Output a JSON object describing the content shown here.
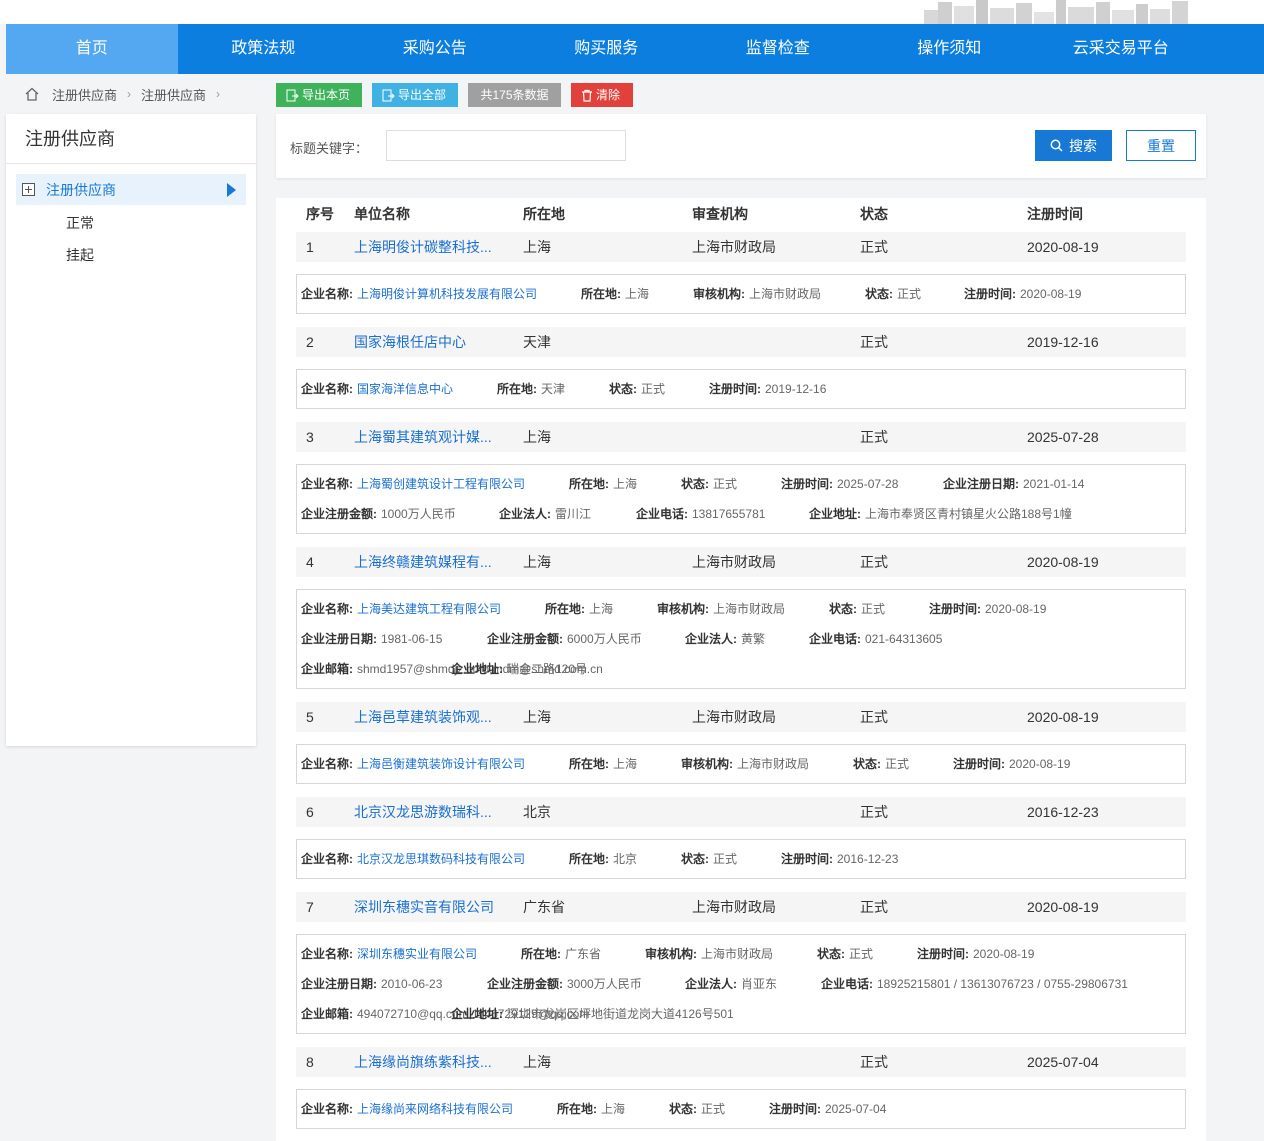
{
  "nav": [
    "首页",
    "政策法规",
    "采购公告",
    "购买服务",
    "监督检查",
    "操作须知",
    "云采交易平台"
  ],
  "breadcrumb": [
    "注册供应商",
    "注册供应商"
  ],
  "toolbar": {
    "export_page": "导出本页",
    "export_all": "导出全部",
    "count": "共175条数据",
    "clear": "清除"
  },
  "sidebar": {
    "title": "注册供应商",
    "active": "注册供应商",
    "subs": [
      "正常",
      "挂起"
    ]
  },
  "search": {
    "label": "标题关键字：",
    "value": "",
    "placeholder": "",
    "search_btn": "搜索",
    "reset_btn": "重置"
  },
  "table": {
    "headers": [
      "序号",
      "单位名称",
      "所在地",
      "审查机构",
      "状态",
      "注册时间"
    ],
    "rows": [
      {
        "idx": "1",
        "name": "上海明俊计碳整科技...",
        "loc": "上海",
        "org": "上海市财政局",
        "status": "正式",
        "time": "2020-08-19",
        "detail": [
          [
            [
              "企业名称:",
              "上海明俊计算机科技发展有限公司",
              true
            ],
            [
              "所在地:",
              "上海"
            ],
            [
              "审核机构:",
              "上海市财政局"
            ],
            [
              "状态:",
              "正式"
            ],
            [
              "注册时间:",
              "2020-08-19"
            ]
          ]
        ]
      },
      {
        "idx": "2",
        "name": "国家海根任店中心",
        "loc": "天津",
        "org": "",
        "status": "正式",
        "time": "2019-12-16",
        "detail": [
          [
            [
              "企业名称:",
              "国家海洋信息中心",
              true
            ],
            [
              "所在地:",
              "天津"
            ],
            [
              "状态:",
              "正式"
            ],
            [
              "注册时间:",
              "2019-12-16"
            ]
          ]
        ]
      },
      {
        "idx": "3",
        "name": "上海蜀其建筑观计媒...",
        "loc": "上海",
        "org": "",
        "status": "正式",
        "time": "2025-07-28",
        "detail": [
          [
            [
              "企业名称:",
              "上海蜀创建筑设计工程有限公司",
              true
            ],
            [
              "所在地:",
              "上海"
            ],
            [
              "状态:",
              "正式"
            ],
            [
              "注册时间:",
              "2025-07-28"
            ],
            [
              "企业注册日期:",
              "2021-01-14"
            ]
          ],
          [
            [
              "企业注册金额:",
              "1000万人民币"
            ],
            [
              "企业法人:",
              "雷川江"
            ],
            [
              "企业电话:",
              "13817655781"
            ],
            [
              "企业地址:",
              "上海市奉贤区青村镇星火公路188号1幢"
            ]
          ]
        ]
      },
      {
        "idx": "4",
        "name": "上海终赣建筑媒程有...",
        "loc": "上海",
        "org": "上海市财政局",
        "status": "正式",
        "time": "2020-08-19",
        "detail": [
          [
            [
              "企业名称:",
              "上海美达建筑工程有限公司",
              true
            ],
            [
              "所在地:",
              "上海"
            ],
            [
              "审核机构:",
              "上海市财政局"
            ],
            [
              "状态:",
              "正式"
            ],
            [
              "注册时间:",
              "2020-08-19"
            ]
          ],
          [
            [
              "企业注册日期:",
              "1981-06-15"
            ],
            [
              "企业注册金额:",
              "6000万人民币"
            ],
            [
              "企业法人:",
              "黄繁"
            ],
            [
              "企业电话:",
              "021-64313605"
            ]
          ],
          [
            [
              "企业邮箱:",
              "shmd1957@shmdjz.com,mdm@shmd.com.cn"
            ],
            [
              "企业地址:",
              "瑞金二路120号"
            ]
          ]
        ]
      },
      {
        "idx": "5",
        "name": "上海邑草建筑装饰观...",
        "loc": "上海",
        "org": "上海市财政局",
        "status": "正式",
        "time": "2020-08-19",
        "detail": [
          [
            [
              "企业名称:",
              "上海邑衡建筑装饰设计有限公司",
              true
            ],
            [
              "所在地:",
              "上海"
            ],
            [
              "审核机构:",
              "上海市财政局"
            ],
            [
              "状态:",
              "正式"
            ],
            [
              "注册时间:",
              "2020-08-19"
            ]
          ]
        ]
      },
      {
        "idx": "6",
        "name": "北京汉龙思游数瑞科...",
        "loc": "北京",
        "org": "",
        "status": "正式",
        "time": "2016-12-23",
        "detail": [
          [
            [
              "企业名称:",
              "北京汉龙思琪数码科技有限公司",
              true
            ],
            [
              "所在地:",
              "北京"
            ],
            [
              "状态:",
              "正式"
            ],
            [
              "注册时间:",
              "2016-12-23"
            ]
          ]
        ]
      },
      {
        "idx": "7",
        "name": "深圳东穗实音有限公司",
        "loc": "广东省",
        "org": "上海市财政局",
        "status": "正式",
        "time": "2020-08-19",
        "detail": [
          [
            [
              "企业名称:",
              "深圳东穗实业有限公司",
              true
            ],
            [
              "所在地:",
              "广东省"
            ],
            [
              "审核机构:",
              "上海市财政局"
            ],
            [
              "状态:",
              "正式"
            ],
            [
              "注册时间:",
              "2020-08-19"
            ]
          ],
          [
            [
              "企业注册日期:",
              "2010-06-23"
            ],
            [
              "企业注册金额:",
              "3000万人民币"
            ],
            [
              "企业法人:",
              "肖亚东"
            ],
            [
              "企业电话:",
              "18925215801 / 13613076723 / 0755-29806731"
            ]
          ],
          [
            [
              "企业邮箱:",
              "494072710@qq.com,1146729129@qq.com"
            ],
            [
              "企业地址:",
              "深圳市龙岗区坪地街道龙岗大道4126号501"
            ]
          ]
        ]
      },
      {
        "idx": "8",
        "name": "上海缘尚旗练紫科技...",
        "loc": "上海",
        "org": "",
        "status": "正式",
        "time": "2025-07-04",
        "detail": [
          [
            [
              "企业名称:",
              "上海缘尚来网络科技有限公司",
              true
            ],
            [
              "所在地:",
              "上海"
            ],
            [
              "状态:",
              "正式"
            ],
            [
              "注册时间:",
              "2025-07-04"
            ]
          ]
        ]
      }
    ]
  }
}
